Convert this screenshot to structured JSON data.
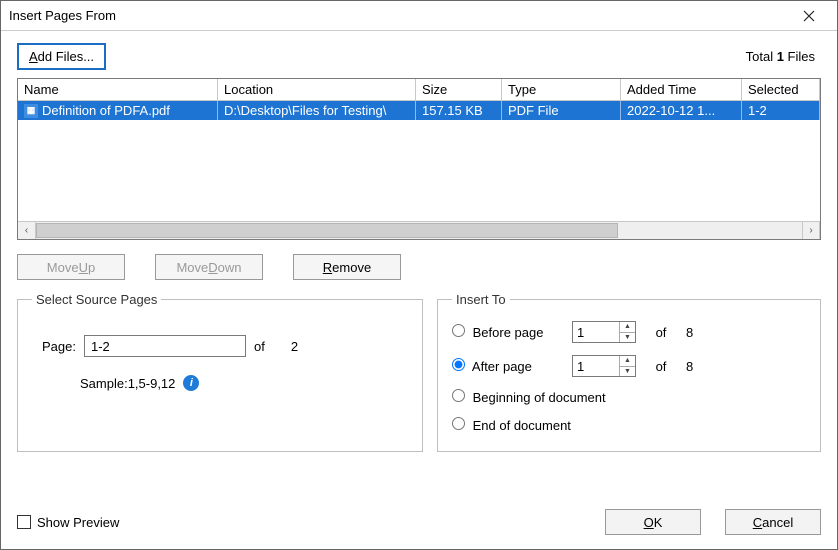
{
  "window": {
    "title": "Insert Pages From"
  },
  "toolbar": {
    "add_files_label": "Add Files...",
    "total_prefix": "Total ",
    "total_count": "1",
    "total_suffix": " Files"
  },
  "table": {
    "headers": {
      "name": "Name",
      "location": "Location",
      "size": "Size",
      "type": "Type",
      "added": "Added Time",
      "selected": "Selected"
    },
    "rows": [
      {
        "name": "Definition of PDFA.pdf",
        "location": "D:\\Desktop\\Files for Testing\\",
        "size": "157.15 KB",
        "type": "PDF File",
        "added": "2022-10-12 1...",
        "selected": "1-2"
      }
    ]
  },
  "buttons": {
    "move_up": "Move Up",
    "move_down": "Move Down",
    "remove": "Remove"
  },
  "source": {
    "legend": "Select Source Pages",
    "page_label": "Page:",
    "page_value": "1-2",
    "of_label": "of",
    "total_pages": "2",
    "sample_label": "Sample:1,5-9,12"
  },
  "insert": {
    "legend": "Insert To",
    "before_label": "Before page",
    "before_value": "1",
    "before_total": "8",
    "after_label": "After page",
    "after_value": "1",
    "after_total": "8",
    "beginning_label": "Beginning of document",
    "end_label": "End of document",
    "of_label": "of"
  },
  "footer": {
    "show_preview": "Show Preview",
    "ok": "OK",
    "cancel": "Cancel"
  }
}
